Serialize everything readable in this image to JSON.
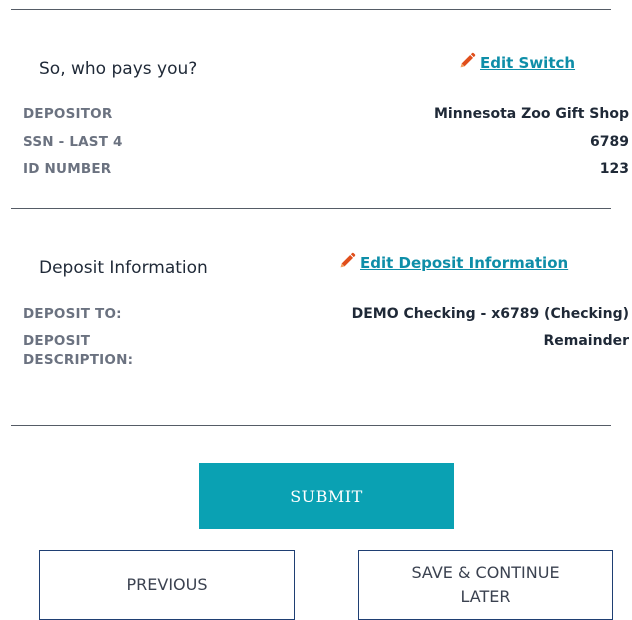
{
  "payer_section": {
    "title": "So, who pays you?",
    "edit_label": "Edit Switch",
    "rows": [
      {
        "label": "DEPOSITOR",
        "value": "Minnesota Zoo Gift Shop"
      },
      {
        "label": "SSN - LAST 4",
        "value": "6789"
      },
      {
        "label": "ID NUMBER",
        "value": "123"
      }
    ]
  },
  "deposit_section": {
    "title": "Deposit Information",
    "edit_label": "Edit Deposit Information",
    "rows": [
      {
        "label": "DEPOSIT TO:",
        "value": "DEMO Checking - x6789 (Checking)"
      },
      {
        "label_line1": "DEPOSIT",
        "label_line2": "DESCRIPTION:",
        "value": "Remainder"
      }
    ]
  },
  "actions": {
    "submit_label": "SUBMIT",
    "previous_label": "PREVIOUS",
    "save_label": "SAVE & CONTINUE LATER"
  },
  "colors": {
    "accent": "#0aa1b3",
    "link": "#0e8ea8",
    "button_border": "#1f3f73",
    "edit_icon": "#e04e1b"
  },
  "icons": {
    "edit": "pencil-icon"
  }
}
